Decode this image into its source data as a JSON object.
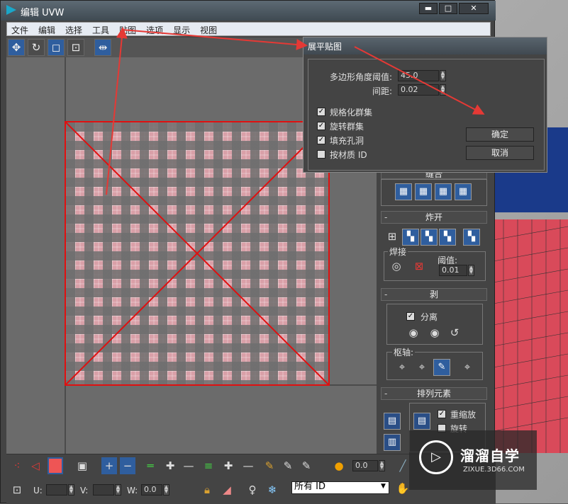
{
  "window": {
    "title": "编辑 UVW",
    "btn_min": "▬",
    "btn_max": "□",
    "btn_close": "✕"
  },
  "menu": [
    "文件",
    "编辑",
    "选择",
    "工具",
    "贴图",
    "选项",
    "显示",
    "视图"
  ],
  "dialog": {
    "title": "展平贴图",
    "angle_label": "多边形角度阈值:",
    "angle_value": "45.0",
    "spacing_label": "间距:",
    "spacing_value": "0.02",
    "checkboxes": [
      {
        "label": "规格化群集",
        "checked": true
      },
      {
        "label": "旋转群集",
        "checked": true
      },
      {
        "label": "填充孔洞",
        "checked": true
      },
      {
        "label": "按材质 ID",
        "checked": false
      }
    ],
    "ok": "确定",
    "cancel": "取消"
  },
  "panel": {
    "stitch_title": "缝合",
    "explode_title": "炸开",
    "weld_label": "焊接",
    "threshold_label": "阈值:",
    "threshold_value": "0.01",
    "peel_title": "剥",
    "detach_label": "分离",
    "detach_checked": true,
    "pivot_label": "枢轴:",
    "arrange_title": "排列元素",
    "rescale_label": "重缩放",
    "rescale_checked": true,
    "rotate_label": "旋转",
    "rotate_checked": false
  },
  "bottom": {
    "spin_value": "0.0",
    "u_label": "U:",
    "v_label": "V:",
    "w_label": "W:",
    "w_value": "0.0",
    "filter_value": "所有 ID"
  },
  "watermark": {
    "title": "溜溜自学",
    "url": "ZIXUE.3D66.COM"
  },
  "colors": {
    "annotation": "#e53935",
    "uv_edge": "#e01010",
    "checker_light": "#d9a0a8",
    "checker_dark": "#6e6e6e",
    "accent_blue": "#2f5e9e"
  }
}
